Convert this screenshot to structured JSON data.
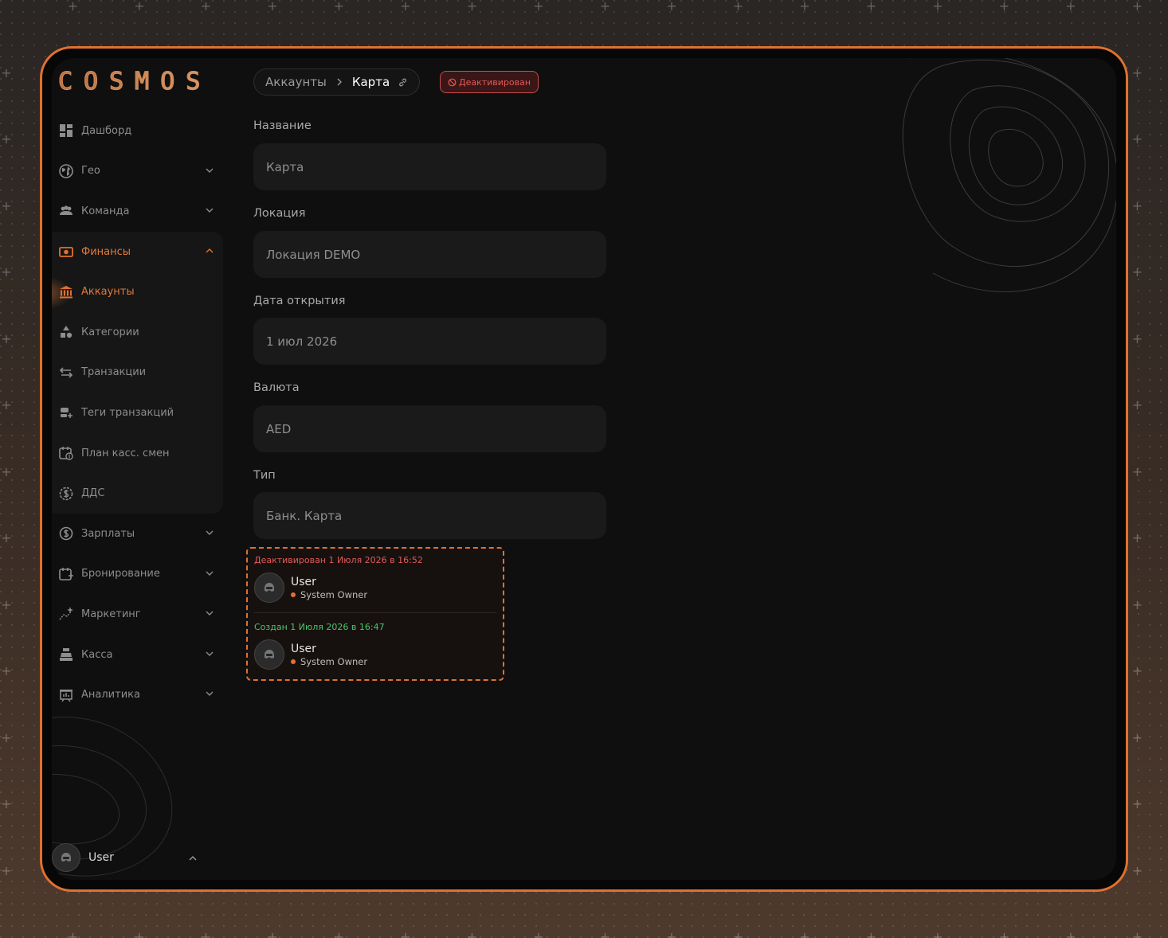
{
  "app": {
    "logo": "COSMOS"
  },
  "sidebar": {
    "items": [
      {
        "label": "Дашборд",
        "icon": "dashboard-icon",
        "chevron": "none"
      },
      {
        "label": "Гео",
        "icon": "globe-icon",
        "chevron": "down"
      },
      {
        "label": "Команда",
        "icon": "team-icon",
        "chevron": "down"
      },
      {
        "label": "Финансы",
        "icon": "money-icon",
        "chevron": "up",
        "active": true
      },
      {
        "label": "Аккаунты",
        "icon": "bank-icon",
        "chevron": "none",
        "active": true
      },
      {
        "label": "Категории",
        "icon": "shapes-icon",
        "chevron": "none"
      },
      {
        "label": "Транзакции",
        "icon": "transfer-icon",
        "chevron": "none"
      },
      {
        "label": "Теги транзакций",
        "icon": "tag-add-icon",
        "chevron": "none"
      },
      {
        "label": "План касс. смен",
        "icon": "calendar-money-icon",
        "chevron": "none"
      },
      {
        "label": "ДДС",
        "icon": "dollar-circle-icon",
        "chevron": "none"
      },
      {
        "label": "Зарплаты",
        "icon": "salary-icon",
        "chevron": "down"
      },
      {
        "label": "Бронирование",
        "icon": "calendar-add-icon",
        "chevron": "down"
      },
      {
        "label": "Маркетинг",
        "icon": "sparkle-chart-icon",
        "chevron": "down"
      },
      {
        "label": "Касса",
        "icon": "cash-register-icon",
        "chevron": "down"
      },
      {
        "label": "Аналитика",
        "icon": "analytics-board-icon",
        "chevron": "down"
      }
    ],
    "user": {
      "name": "User"
    }
  },
  "breadcrumb": {
    "parent": "Аккаунты",
    "current": "Карта"
  },
  "status_badge": "Деактивирован",
  "form": {
    "name_label": "Название",
    "name_value": "Карта",
    "location_label": "Локация",
    "location_value": "Локация DEMO",
    "date_label": "Дата открытия",
    "date_value": "1 июл 2026",
    "currency_label": "Валюта",
    "currency_value": "AED",
    "type_label": "Тип",
    "type_value": "Банк. Карта"
  },
  "history": [
    {
      "title": "Деактивирован 1 Июля 2026 в 16:52",
      "user": "User",
      "role": "System Owner"
    },
    {
      "title": "Создан 1 Июля 2026 в 16:47",
      "user": "User",
      "role": "System Owner"
    }
  ],
  "colors": {
    "accent": "#e0712f",
    "danger": "#e35a5a",
    "success": "#4cc46b"
  }
}
